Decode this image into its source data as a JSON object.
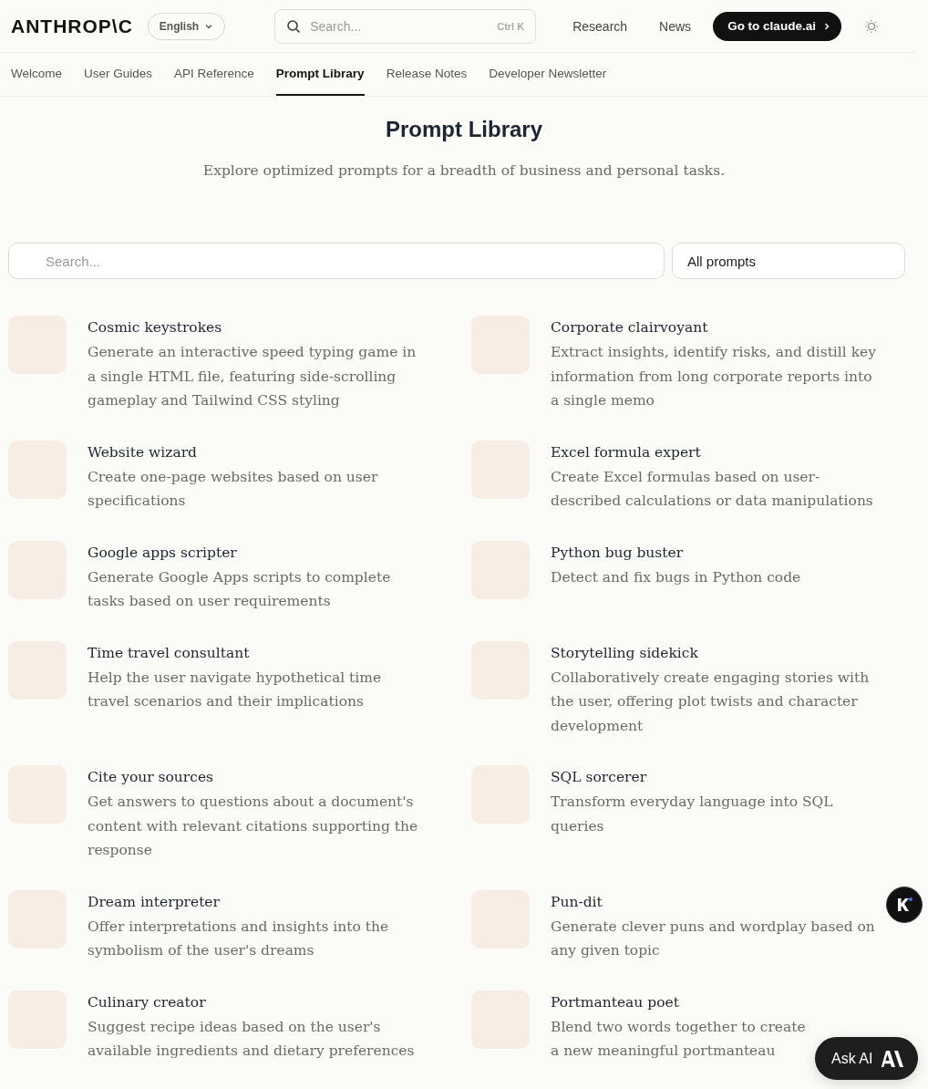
{
  "header": {
    "logo": "ANTHROP\\C",
    "language": "English",
    "search": {
      "placeholder": "Search...",
      "shortcut": "Ctrl K"
    },
    "links": [
      "Research",
      "News"
    ],
    "cta": "Go to claude.ai"
  },
  "tabs": [
    {
      "label": "Welcome",
      "selected": false
    },
    {
      "label": "User Guides",
      "selected": false
    },
    {
      "label": "API Reference",
      "selected": false
    },
    {
      "label": "Prompt Library",
      "selected": true
    },
    {
      "label": "Release Notes",
      "selected": false
    },
    {
      "label": "Developer Newsletter",
      "selected": false
    }
  ],
  "title": "Prompt Library",
  "subtitle": "Explore optimized prompts for a breadth of business and personal tasks.",
  "filter": {
    "search_placeholder": "Search...",
    "category": "All prompts"
  },
  "prompts": [
    {
      "title": "Cosmic keystrokes",
      "description": "Generate an interactive speed typing game in a single HTML file, featuring side-scrolling gameplay and Tailwind CSS styling"
    },
    {
      "title": "Corporate clairvoyant",
      "description": "Extract insights, identify risks, and distill key information from long corporate reports into a single memo"
    },
    {
      "title": "Website wizard",
      "description": "Create one-page websites based on user specifications"
    },
    {
      "title": "Excel formula expert",
      "description": "Create Excel formulas based on user-described calculations or data manipulations"
    },
    {
      "title": "Google apps scripter",
      "description": "Generate Google Apps scripts to complete tasks based on user requirements"
    },
    {
      "title": "Python bug buster",
      "description": "Detect and fix bugs in Python code"
    },
    {
      "title": "Time travel consultant",
      "description": "Help the user navigate hypothetical time travel scenarios and their implications"
    },
    {
      "title": "Storytelling sidekick",
      "description": "Collaboratively create engaging stories with the user, offering plot twists and character development"
    },
    {
      "title": "Cite your sources",
      "description": "Get answers to questions about a document's content with relevant citations supporting the response"
    },
    {
      "title": "SQL sorcerer",
      "description": "Transform everyday language into SQL queries"
    },
    {
      "title": "Dream interpreter",
      "description": "Offer interpretations and insights into the symbolism of the user's dreams"
    },
    {
      "title": "Pun-dit",
      "description": "Generate clever puns and wordplay based on any given topic"
    },
    {
      "title": "Culinary creator",
      "description": "Suggest recipe ideas based on the user's available ingredients and dietary preferences"
    },
    {
      "title": "Portmanteau poet",
      "description": "Blend two words together to create a new meaningful portmanteau"
    }
  ],
  "ask_ai": "Ask AI"
}
